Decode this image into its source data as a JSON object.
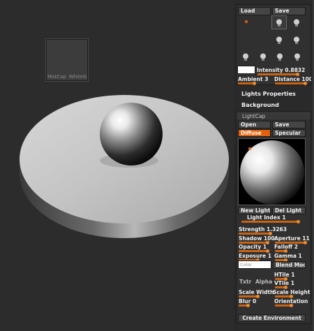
{
  "viewport": {
    "thumbnail": {
      "label_left": "MatCap",
      "label_right": "WhiteG"
    }
  },
  "light": {
    "load_label": "Load",
    "save_label": "Save",
    "intensity_label": "Intensity",
    "intensity_value": "0.8832",
    "intensity_fraction": 0.8832,
    "ambient_label": "Ambient",
    "ambient_value": "3",
    "distance_label": "Distance",
    "distance_value": "100",
    "lights_properties": "Lights Properties",
    "background": "Background",
    "bulbs": [
      "bulb-1",
      "bulb-2",
      "bulb-3",
      "bulb-4",
      "bulb-5",
      "bulb-6",
      "bulb-7",
      "bulb-8"
    ]
  },
  "lightcap": {
    "title": "LightCap",
    "open_label": "Open",
    "save_label": "Save",
    "diffuse_label": "Diffuse",
    "specular_label": "Specular",
    "new_light_label": "New Light",
    "del_light_label": "Del Light",
    "light_index_label": "Light Index",
    "light_index_value": "1",
    "strength_label": "Strength",
    "strength_value": "1.3263",
    "shadow_label": "Shadow",
    "shadow_value": "100",
    "aperture_label": "Aperture",
    "aperture_value": "11",
    "opacity_label": "Opacity",
    "opacity_value": "1",
    "falloff_label": "Falloff",
    "falloff_value": "2",
    "exposure_label": "Exposure",
    "exposure_value": "1",
    "gamma_label": "Gamma",
    "gamma_value": "1",
    "color_placeholder": "Color",
    "blend_mode_label": "Blend Mode",
    "txtr_label": "Txtr",
    "alpha_label": "Alpha",
    "htile_label": "HTile",
    "htile_value": "1",
    "vtile_label": "VTile",
    "vtile_value": "1",
    "scale_width_label": "Scale Width",
    "scale_height_label": "Scale Height",
    "blur_label": "Blur",
    "blur_value": "0",
    "orientation_label": "Orientation",
    "create_environment_label": "Create Environment"
  },
  "colors": {
    "accent": "#e0600c",
    "panel_bg": "#2a2a2a",
    "viewport_bg": "#2c2c2c"
  }
}
